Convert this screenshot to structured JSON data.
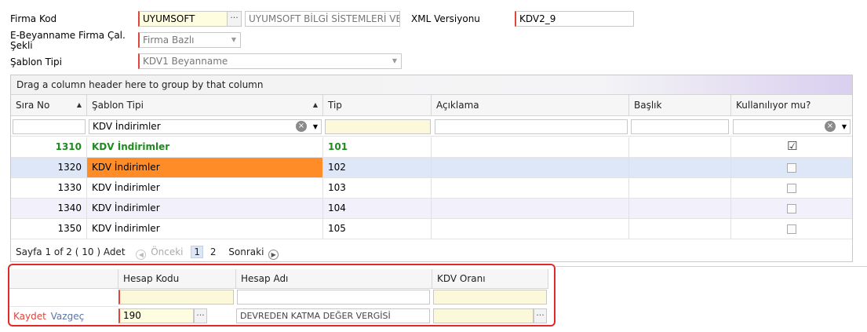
{
  "form": {
    "firma_kod_label": "Firma Kod",
    "firma_kod_value": "UYUMSOFT",
    "firma_name_value": "UYUMSOFT BİLGİ SİSTEMLERİ VE",
    "xml_label": "XML Versiyonu",
    "xml_value": "KDV2_9",
    "beyanname_label_1": "E-Beyanname Firma Çal.",
    "beyanname_label_2": "Şekli",
    "beyanname_value": "Firma Bazlı",
    "sablon_label": "Şablon Tipi",
    "sablon_value": "KDV1 Beyanname",
    "more_glyph": "···"
  },
  "grid": {
    "group_hint": "Drag a column header here to group by that column",
    "columns": [
      "Sıra No",
      "Şablon Tipi",
      "Tip",
      "Açıklama",
      "Başlık",
      "Kullanılıyor mu?"
    ],
    "filter_sablon": "KDV İndirimler",
    "rows": [
      {
        "sira": "1310",
        "sablon": "KDV İndirimler",
        "tip": "101",
        "checked": true
      },
      {
        "sira": "1320",
        "sablon": "KDV İndirimler",
        "tip": "102",
        "checked": false
      },
      {
        "sira": "1330",
        "sablon": "KDV İndirimler",
        "tip": "103",
        "checked": false
      },
      {
        "sira": "1340",
        "sablon": "KDV İndirimler",
        "tip": "104",
        "checked": false
      },
      {
        "sira": "1350",
        "sablon": "KDV İndirimler",
        "tip": "105",
        "checked": false
      }
    ],
    "pager": {
      "info": "Sayfa 1 of 2 ( 10 ) Adet",
      "prev": "Önceki",
      "page1": "1",
      "page2": "2",
      "next": "Sonraki"
    }
  },
  "detail": {
    "columns": [
      "Hesap Kodu",
      "Hesap Adı",
      "KDV Oranı"
    ],
    "save": "Kaydet",
    "cancel": "Vazgeç",
    "hesap_kodu": "190",
    "hesap_adi": "DEVREDEN KATMA DEĞER VERGİSİ"
  },
  "colors": {
    "accent_green": "#1f8a1f",
    "selected_orange": "#ff8c26",
    "selected_row": "#dde7f8",
    "alt_row": "#f2f1fb",
    "error_red": "#e02a2a"
  }
}
